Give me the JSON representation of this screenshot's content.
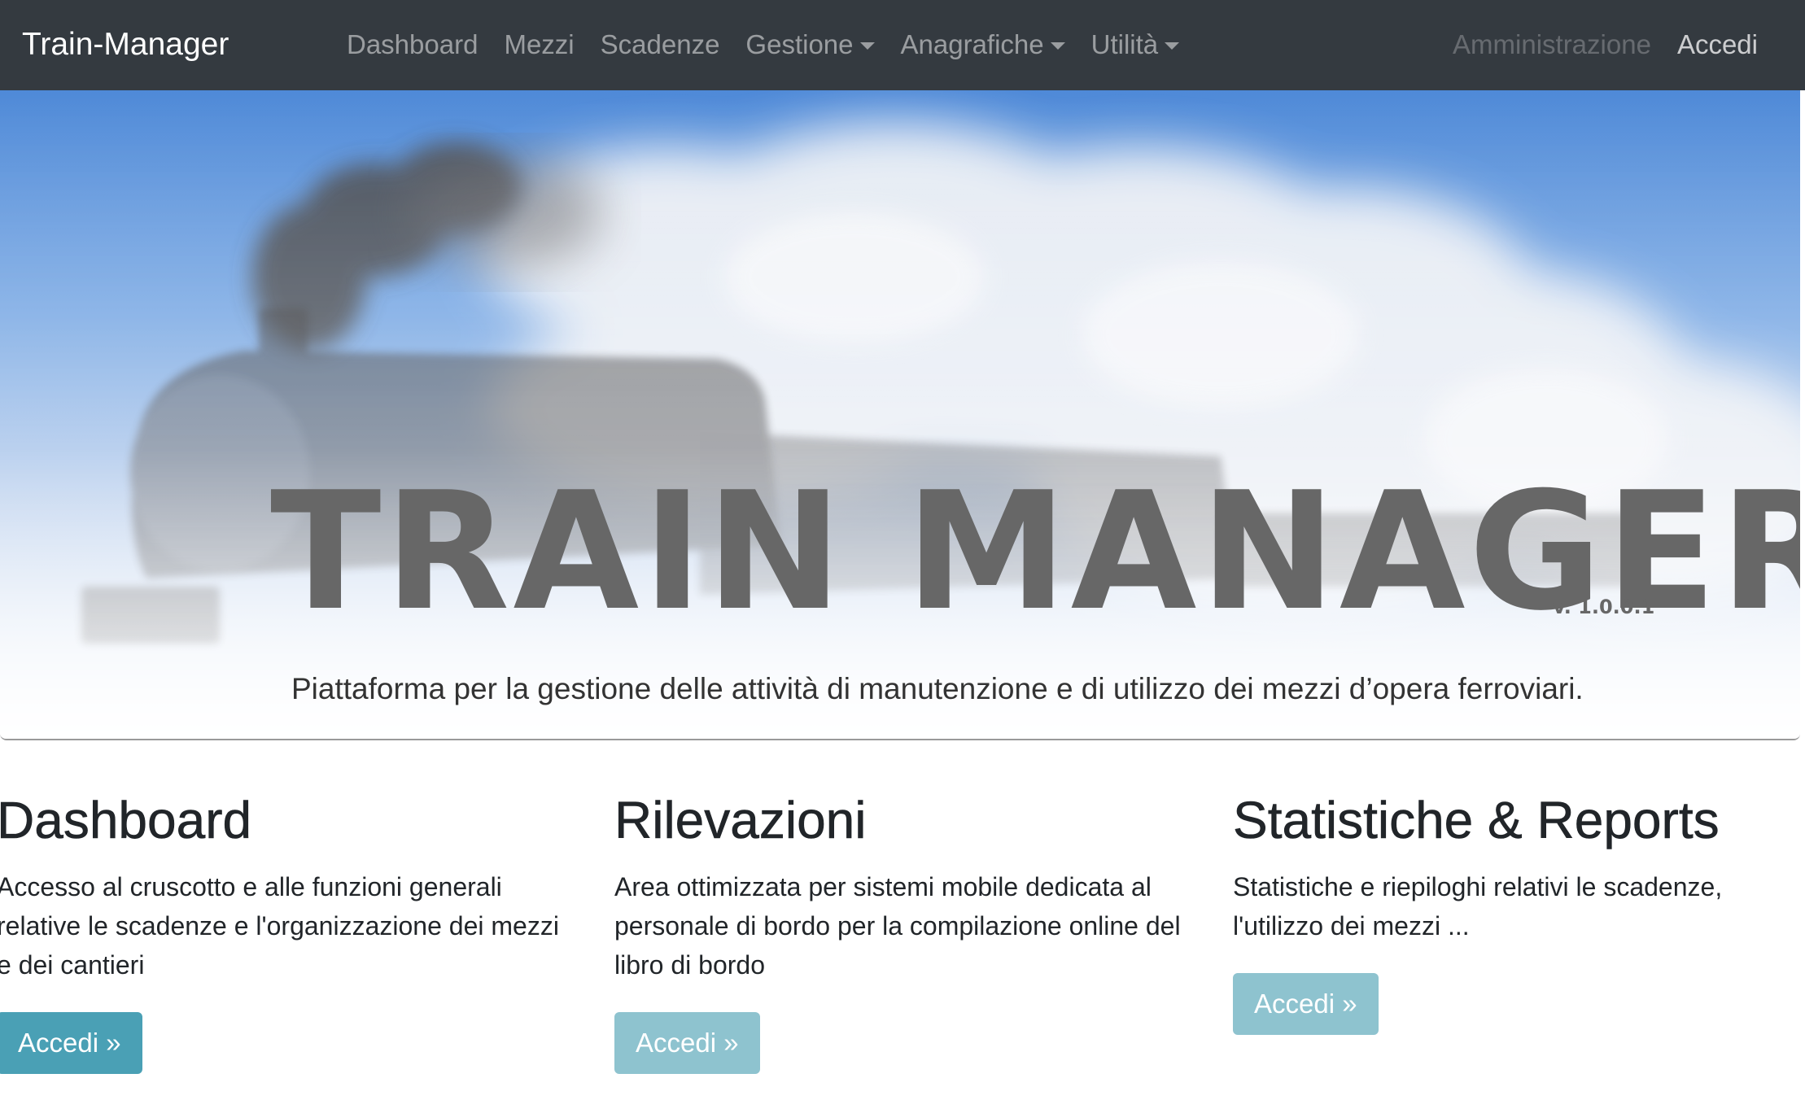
{
  "navbar": {
    "brand": "Train-Manager",
    "links": [
      {
        "label": "Dashboard"
      },
      {
        "label": "Mezzi"
      },
      {
        "label": "Scadenze"
      },
      {
        "label": "Gestione"
      },
      {
        "label": "Anagrafiche"
      },
      {
        "label": "Utilità"
      }
    ],
    "right": {
      "admin": "Amministrazione",
      "login": "Accedi"
    }
  },
  "hero": {
    "title": "TRAIN MANAGER",
    "version": "v. 1.0.0.1",
    "lead": "Piattaforma per la gestione delle attività di manutenzione e di utilizzo dei mezzi d’opera ferroviari."
  },
  "columns": [
    {
      "heading": "Dashboard",
      "text": "Accesso al cruscotto e alle funzioni generali relative le scadenze e l'organizzazione dei mezzi e dei cantieri",
      "button": "Accedi »"
    },
    {
      "heading": "Rilevazioni",
      "text": "Area ottimizzata per sistemi mobile dedicata al personale di bordo per la compilazione online del libro di bordo",
      "button": "Accedi »"
    },
    {
      "heading": "Statistiche & Reports",
      "text": "Statistiche e riepiloghi relativi le scadenze, l'utilizzo dei mezzi ...",
      "button": "Accedi »"
    }
  ],
  "colors": {
    "navbar_bg": "#343a40",
    "button_primary": "#4aa0b5",
    "button_disabled": "#8ec3cf",
    "hero_title": "#676767"
  }
}
